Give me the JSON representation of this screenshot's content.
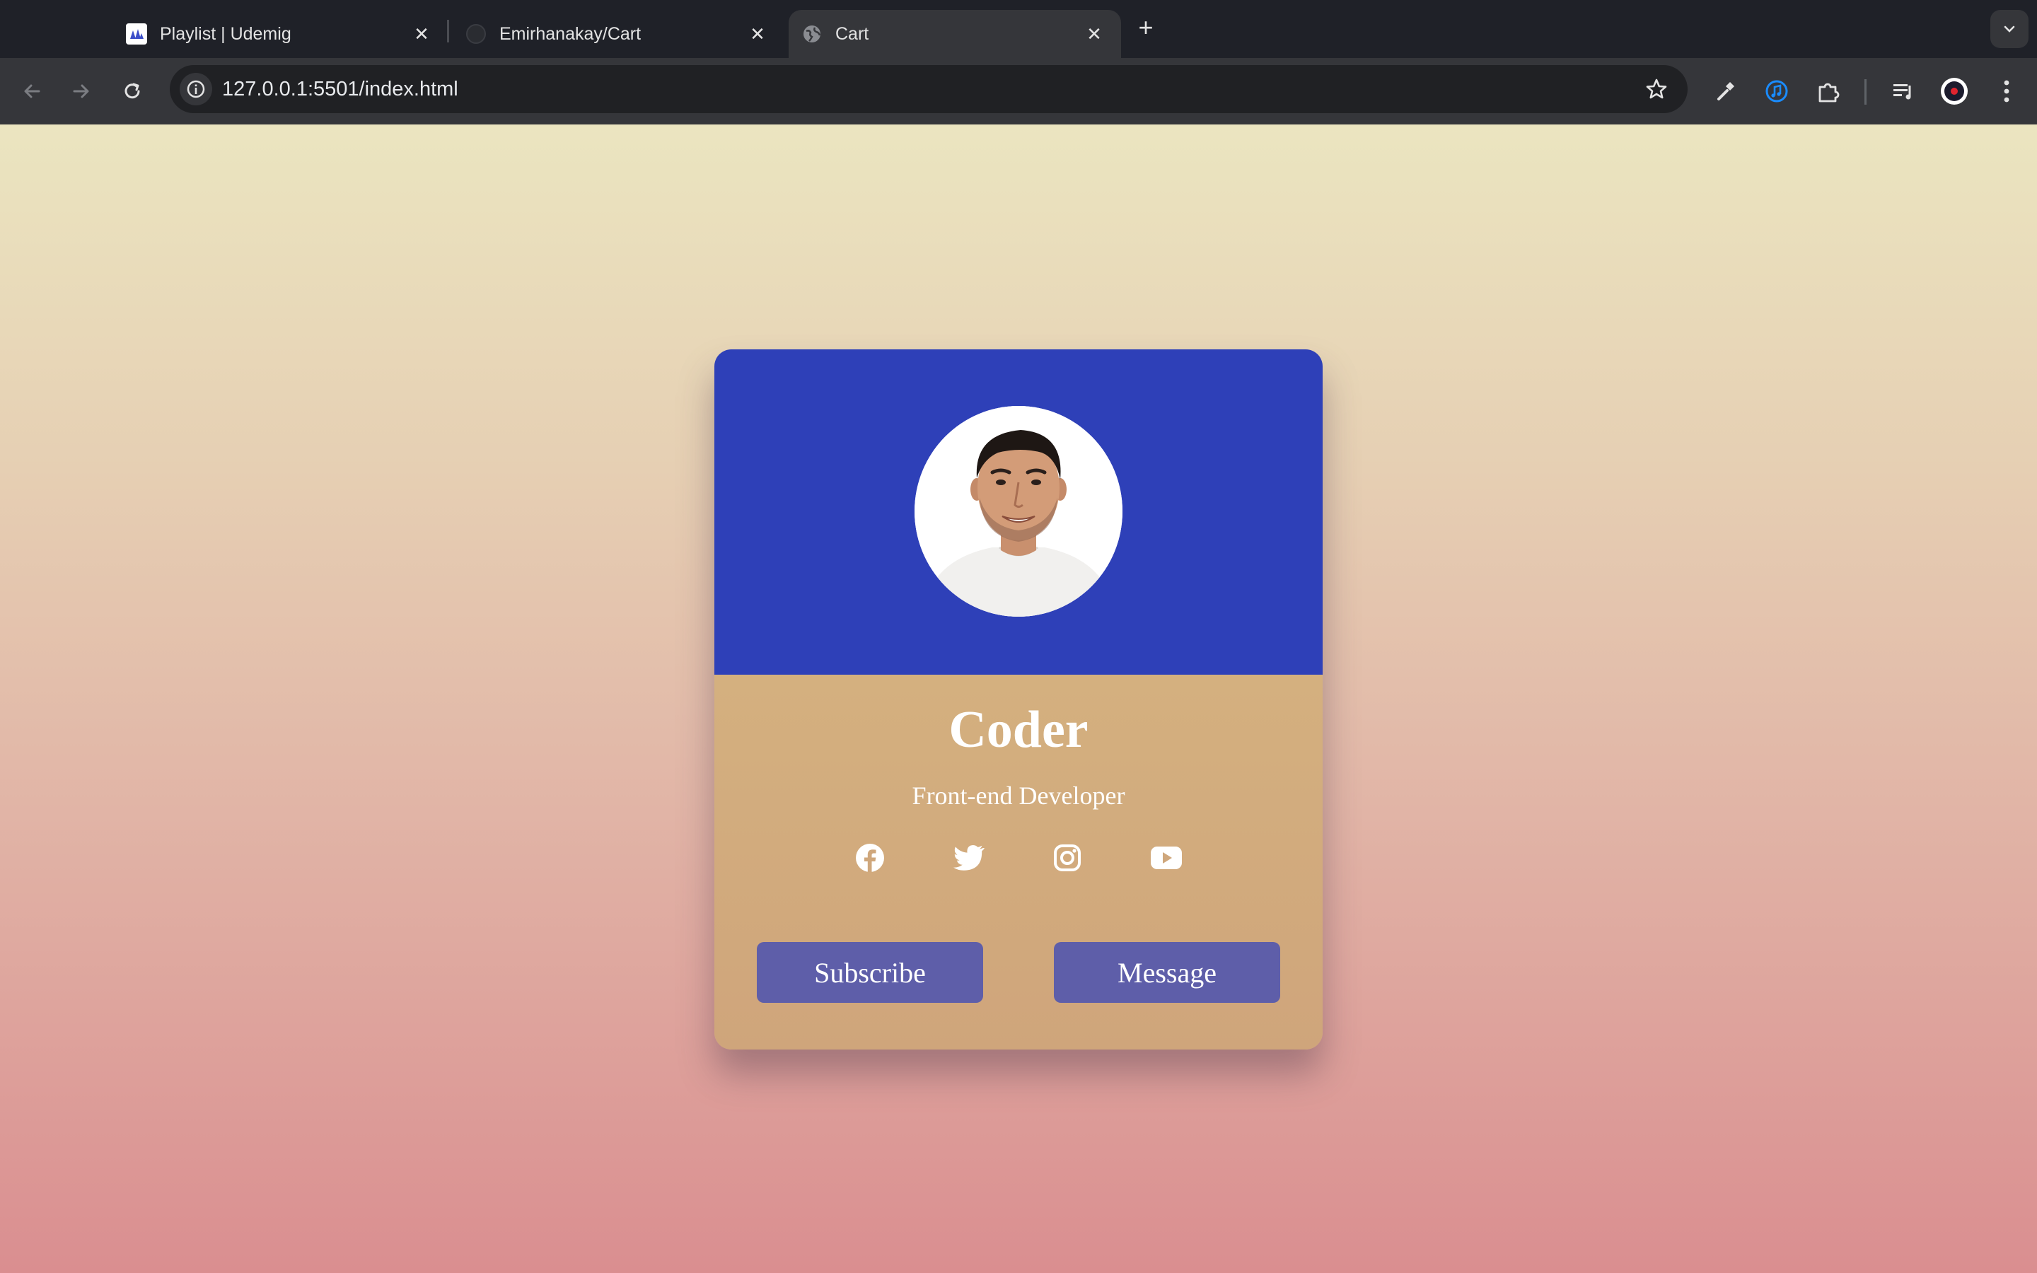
{
  "browser": {
    "tabs": [
      {
        "title": "Playlist | Udemig",
        "icon": "udemig-favicon",
        "active": false
      },
      {
        "title": "Emirhanakay/Cart",
        "icon": "github-favicon",
        "active": false
      },
      {
        "title": "Cart",
        "icon": "globe-favicon",
        "active": true
      }
    ],
    "new_tab_label": "+",
    "close_label": "✕",
    "url": "127.0.0.1:5501/index.html",
    "extensions": [
      "eyedropper-icon",
      "music-extension-icon",
      "puzzle-extension-icon",
      "media-control-icon",
      "profile-avatar-icon",
      "more-menu-icon"
    ]
  },
  "card": {
    "name": "Coder",
    "role": "Front-end Developer",
    "socials": [
      "facebook-icon",
      "twitter-icon",
      "instagram-icon",
      "youtube-icon"
    ],
    "buttons": {
      "subscribe": "Subscribe",
      "message": "Message"
    }
  },
  "colors": {
    "card_header": "#2e40b8",
    "card_body": "#d4b07f",
    "button": "#5e5ea9",
    "page_gradient_top": "#ebe5c0",
    "page_gradient_bottom": "#da8e90"
  }
}
